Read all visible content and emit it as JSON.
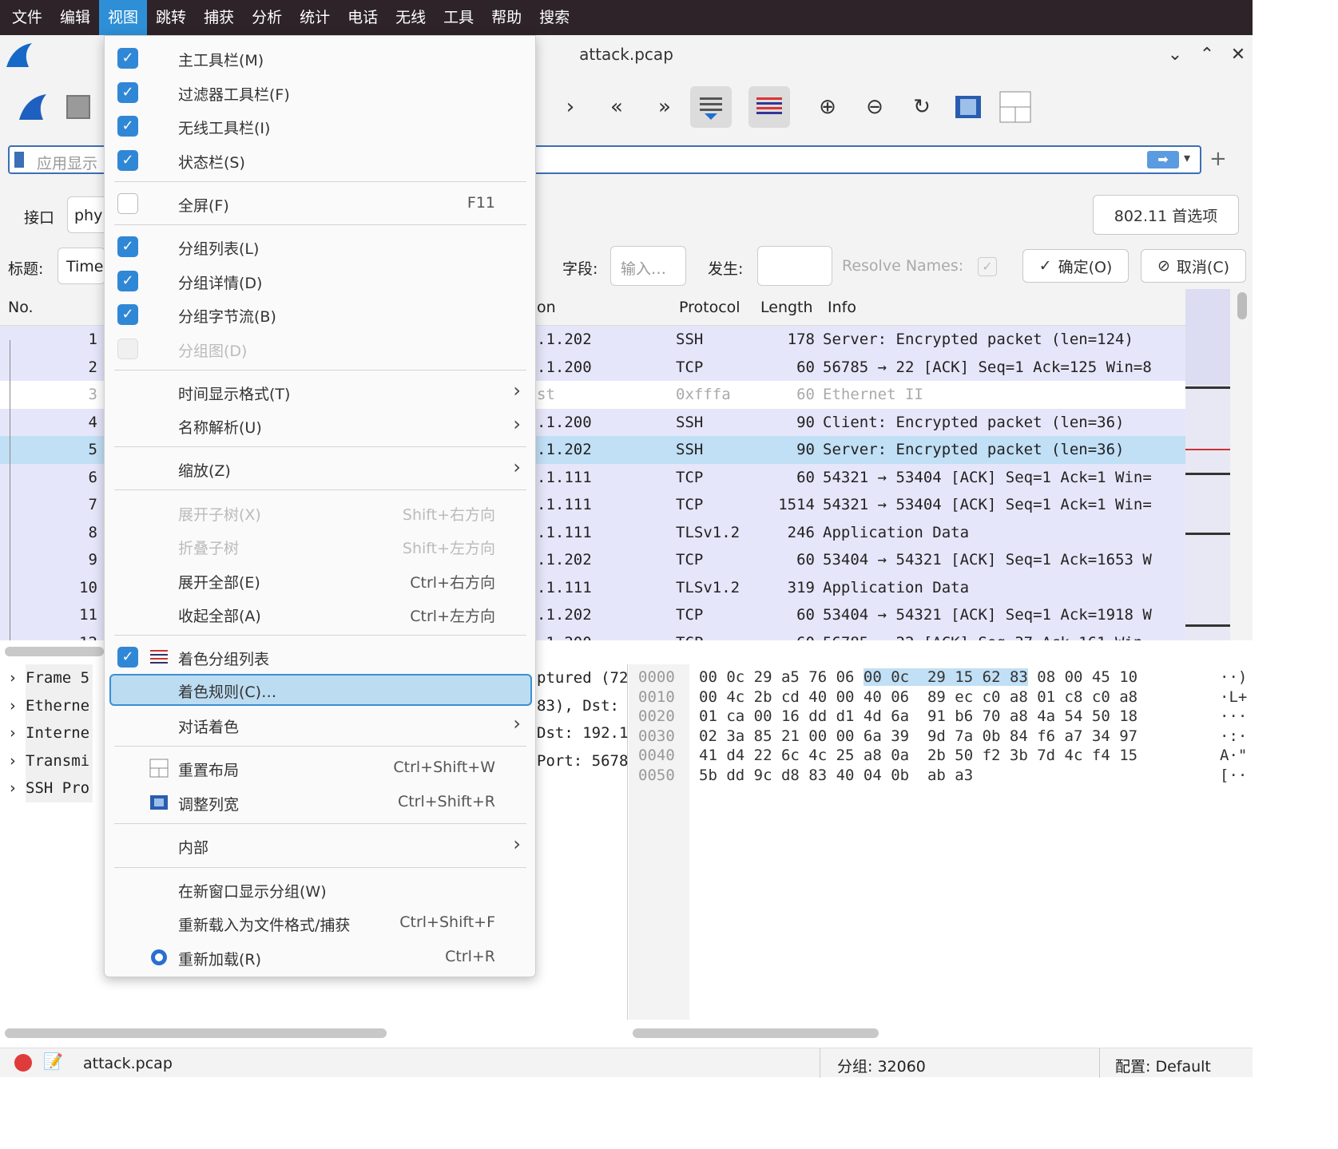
{
  "menubar": {
    "items": [
      "文件",
      "编辑",
      "视图",
      "跳转",
      "捕获",
      "分析",
      "统计",
      "电话",
      "无线",
      "工具",
      "帮助",
      "搜索"
    ],
    "active_index": 2
  },
  "window": {
    "title": "attack.pcap"
  },
  "filter": {
    "placeholder": "应用显示"
  },
  "wireless": {
    "interface_label": "接口",
    "interface_value": "phy",
    "prefs_button": "802.11 首选项"
  },
  "column_editor": {
    "title_label": "标题:",
    "title_value": "Time",
    "field_label": "字段:",
    "field_placeholder": "输入…",
    "occurrence_label": "发生:",
    "resolve_label": "Resolve Names:",
    "ok_button": "确定(O)",
    "cancel_button": "取消(C)"
  },
  "packet_list": {
    "headers": {
      "no": "No.",
      "dest": "on",
      "protocol": "Protocol",
      "length": "Length",
      "info": "Info"
    },
    "rows": [
      {
        "no": "1",
        "dest": ".1.202",
        "protocol": "SSH",
        "length": "178",
        "info": "Server: Encrypted packet (len=124)",
        "style": "normal"
      },
      {
        "no": "2",
        "dest": ".1.200",
        "protocol": "TCP",
        "length": "60",
        "info": "56785 → 22 [ACK] Seq=1 Ack=125 Win=8",
        "style": "normal"
      },
      {
        "no": "3",
        "dest": "st",
        "protocol": "0xfffa",
        "length": "60",
        "info": "Ethernet II",
        "style": "dim"
      },
      {
        "no": "4",
        "dest": ".1.200",
        "protocol": "SSH",
        "length": "90",
        "info": "Client: Encrypted packet (len=36)",
        "style": "normal"
      },
      {
        "no": "5",
        "dest": ".1.202",
        "protocol": "SSH",
        "length": "90",
        "info": "Server: Encrypted packet (len=36)",
        "style": "sel"
      },
      {
        "no": "6",
        "dest": ".1.111",
        "protocol": "TCP",
        "length": "60",
        "info": "54321 → 53404 [ACK] Seq=1 Ack=1 Win=",
        "style": "normal"
      },
      {
        "no": "7",
        "dest": ".1.111",
        "protocol": "TCP",
        "length": "1514",
        "info": "54321 → 53404 [ACK] Seq=1 Ack=1 Win=",
        "style": "normal"
      },
      {
        "no": "8",
        "dest": ".1.111",
        "protocol": "TLSv1.2",
        "length": "246",
        "info": "Application Data",
        "style": "normal"
      },
      {
        "no": "9",
        "dest": ".1.202",
        "protocol": "TCP",
        "length": "60",
        "info": "53404 → 54321 [ACK] Seq=1 Ack=1653 W",
        "style": "normal"
      },
      {
        "no": "10",
        "dest": ".1.111",
        "protocol": "TLSv1.2",
        "length": "319",
        "info": "Application Data",
        "style": "normal"
      },
      {
        "no": "11",
        "dest": ".1.202",
        "protocol": "TCP",
        "length": "60",
        "info": "53404 → 54321 [ACK] Seq=1 Ack=1918 W",
        "style": "normal"
      },
      {
        "no": "12",
        "dest": ".1.200",
        "protocol": "TCP",
        "length": "60",
        "info": "56785 → 22 [ACK] Seq=37 Ack=161 Win=",
        "style": "normal"
      }
    ]
  },
  "details": {
    "rows": [
      {
        "left": "Frame 5",
        "right": "ptured (72"
      },
      {
        "left": "Etherne",
        "right": "83), Dst:"
      },
      {
        "left": "Interne",
        "right": "Dst: 192.1"
      },
      {
        "left": "Transmi",
        "right": "Port: 5678"
      },
      {
        "left": "SSH Pro",
        "right": ""
      }
    ]
  },
  "bytes": {
    "rows": [
      {
        "offset": "0000",
        "hex_a": "00 0c 29 a5 76 06",
        "hex_hl": "00 0c  29 15 62 83",
        "hex_b": " 08 00 45 10",
        "ascii": "··)"
      },
      {
        "offset": "0010",
        "hex_a": "00 4c 2b cd 40 00 40 06  89 ec c0 a8 01 c8 c0 a8",
        "hex_hl": "",
        "hex_b": "",
        "ascii": "·L+"
      },
      {
        "offset": "0020",
        "hex_a": "01 ca 00 16 dd d1 4d 6a  91 b6 70 a8 4a 54 50 18",
        "hex_hl": "",
        "hex_b": "",
        "ascii": "···"
      },
      {
        "offset": "0030",
        "hex_a": "02 3a 85 21 00 00 6a 39  9d 7a 0b 84 f6 a7 34 97",
        "hex_hl": "",
        "hex_b": "",
        "ascii": "·:·"
      },
      {
        "offset": "0040",
        "hex_a": "41 d4 22 6c 4c 25 a8 0a  2b 50 f2 3b 7d 4c f4 15",
        "hex_hl": "",
        "hex_b": "",
        "ascii": "A·\""
      },
      {
        "offset": "0050",
        "hex_a": "5b dd 9c d8 83 40 04 0b  ab a3",
        "hex_hl": "",
        "hex_b": "",
        "ascii": "[··"
      }
    ]
  },
  "statusbar": {
    "file": "attack.pcap",
    "packets": "分组: 32060",
    "profile": "配置: Default"
  },
  "view_menu": {
    "items": [
      {
        "label": "主工具栏(M)",
        "shortcut": "",
        "check": "on"
      },
      {
        "label": "过滤器工具栏(F)",
        "shortcut": "",
        "check": "on"
      },
      {
        "label": "无线工具栏(I)",
        "shortcut": "",
        "check": "on"
      },
      {
        "label": "状态栏(S)",
        "shortcut": "",
        "check": "on"
      },
      {
        "label": "全屏(F)",
        "shortcut": "F11",
        "check": "off"
      },
      {
        "label": "分组列表(L)",
        "shortcut": "",
        "check": "on"
      },
      {
        "label": "分组详情(D)",
        "shortcut": "",
        "check": "on"
      },
      {
        "label": "分组字节流(B)",
        "shortcut": "",
        "check": "on"
      },
      {
        "label": "分组图(D)",
        "shortcut": "",
        "check": "disabled"
      },
      {
        "label": "时间显示格式(T)",
        "shortcut": "",
        "check": "none"
      },
      {
        "label": "名称解析(U)",
        "shortcut": "",
        "check": "none"
      },
      {
        "label": "缩放(Z)",
        "shortcut": "",
        "check": "none"
      },
      {
        "label": "展开子树(X)",
        "shortcut": "Shift+右方向",
        "check": "none"
      },
      {
        "label": "折叠子树",
        "shortcut": "Shift+左方向",
        "check": "none"
      },
      {
        "label": "展开全部(E)",
        "shortcut": "Ctrl+右方向",
        "check": "none"
      },
      {
        "label": "收起全部(A)",
        "shortcut": "Ctrl+左方向",
        "check": "none"
      },
      {
        "label": "着色分组列表",
        "shortcut": "",
        "check": "on"
      },
      {
        "label": "着色规则(C)…",
        "shortcut": "",
        "check": "none"
      },
      {
        "label": "对话着色",
        "shortcut": "",
        "check": "none"
      },
      {
        "label": "重置布局",
        "shortcut": "Ctrl+Shift+W",
        "check": "none"
      },
      {
        "label": "调整列宽",
        "shortcut": "Ctrl+Shift+R",
        "check": "none"
      },
      {
        "label": "内部",
        "shortcut": "",
        "check": "none"
      },
      {
        "label": "在新窗口显示分组(W)",
        "shortcut": "",
        "check": "none"
      },
      {
        "label": "重新载入为文件格式/捕获",
        "shortcut": "Ctrl+Shift+F",
        "check": "none"
      },
      {
        "label": "重新加载(R)",
        "shortcut": "Ctrl+R",
        "check": "none"
      }
    ]
  },
  "colors": {
    "accent": "#2e8fd6",
    "row_bg": "#e6e6fa",
    "row_selected": "#c1dff5",
    "menubar_bg": "#2d2328"
  }
}
